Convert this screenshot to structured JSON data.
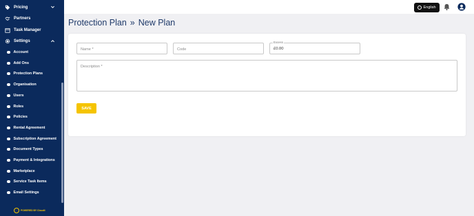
{
  "sidebar": {
    "items": [
      {
        "label": "Pricing",
        "icon": "tag-icon",
        "expanded": false
      },
      {
        "label": "Partners",
        "icon": "handshake-icon"
      },
      {
        "label": "Task Manager",
        "icon": "calendar-icon"
      },
      {
        "label": "Settings",
        "icon": "gear-icon",
        "expanded": true
      }
    ],
    "settings_children": [
      "Account",
      "Add Ons",
      "Protection Plans",
      "Organisation",
      "Users",
      "Roles",
      "Policies",
      "Rental Agreement",
      "Subscription Agreement",
      "Document Types",
      "Payment & Integrations",
      "Marketplace",
      "Service Task Items",
      "Email Settings"
    ],
    "powered_by": "POWERED BY Cloudii"
  },
  "topbar": {
    "language": "English"
  },
  "breadcrumb": {
    "parent": "Protection Plan",
    "separator": "»",
    "current": "New Plan"
  },
  "form": {
    "name_placeholder": "Name *",
    "code_placeholder": "Code",
    "excess_label": "Excess",
    "excess_value": "£0.00",
    "description_placeholder": "Description *",
    "save_label": "SAVE"
  },
  "colors": {
    "sidebar_bg": "#0b2a5c",
    "accent": "#f5c400",
    "title": "#1f3a6a"
  }
}
